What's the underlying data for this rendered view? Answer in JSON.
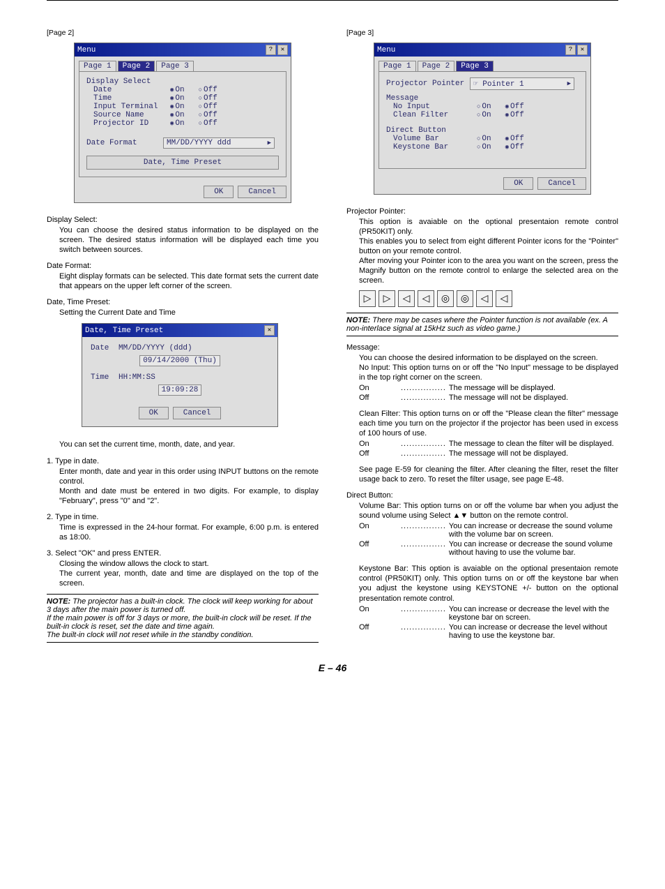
{
  "page2": {
    "heading": "[Page 2]",
    "dialog": {
      "title": "Menu",
      "tabs": [
        "Page 1",
        "Page 2",
        "Page 3"
      ],
      "activeTab": 1,
      "group": "Display Select",
      "rows": [
        {
          "label": "Date",
          "on": "On",
          "off": "Off",
          "sel": "on"
        },
        {
          "label": "Time",
          "on": "On",
          "off": "Off",
          "sel": "on"
        },
        {
          "label": "Input Terminal",
          "on": "On",
          "off": "Off",
          "sel": "on"
        },
        {
          "label": "Source Name",
          "on": "On",
          "off": "Off",
          "sel": "on"
        },
        {
          "label": "Projector ID",
          "on": "On",
          "off": "Off",
          "sel": "on"
        }
      ],
      "dateFormatLabel": "Date Format",
      "dateFormatValue": "MM/DD/YYYY ddd",
      "presetBtn": "Date, Time Preset",
      "ok": "OK",
      "cancel": "Cancel"
    },
    "displaySelect": {
      "title": "Display Select:",
      "p1": "You can choose the desired status information to be displayed on the screen. The desired status information will be displayed each time you switch between sources."
    },
    "dateFormat": {
      "title": "Date Format:",
      "p1": "Eight display formats can be selected. This date format sets the current date that appears on the upper left corner of the screen."
    },
    "dateTimePreset": {
      "title": "Date, Time Preset:",
      "p1": "Setting the Current Date and Time"
    },
    "dtDialog": {
      "title": "Date, Time Preset",
      "dateLabel": "Date",
      "dateFmt": "MM/DD/YYYY (ddd)",
      "dateVal": "09/14/2000 (Thu)",
      "timeLabel": "Time",
      "timeFmt": "HH:MM:SS",
      "timeVal": "19:09:28",
      "ok": "OK",
      "cancel": "Cancel"
    },
    "afterDt": "You can set the current time, month, date, and year.",
    "step1": {
      "h": "1. Type in date.",
      "p1": "Enter month, date and year in this order using INPUT buttons on the remote control.",
      "p2": "Month and date must be entered in two digits. For example, to display \"February\", press \"0\" and \"2\"."
    },
    "step2": {
      "h": "2. Type in time.",
      "p1": "Time is expressed in the 24-hour format. For example, 6:00 p.m. is entered as 18:00."
    },
    "step3": {
      "h": "3. Select \"OK\" and press ENTER.",
      "p1": "Closing the window allows the clock to start.",
      "p2": "The current year, month, date and time are displayed on the top of the screen."
    },
    "note1": {
      "label": "NOTE:",
      "l1": "The projector has a built-in clock. The clock will keep working for about 3 days after the main power is turned off.",
      "l2": "If the main power is off for 3 days or more, the built-in clock will be reset. If the built-in clock is reset, set the date and time again.",
      "l3": "The built-in clock will not reset while in the standby condition."
    }
  },
  "page3": {
    "heading": "[Page 3]",
    "dialog": {
      "title": "Menu",
      "tabs": [
        "Page 1",
        "Page 2",
        "Page 3"
      ],
      "activeTab": 2,
      "pointerLabel": "Projector Pointer",
      "pointerValue": "Pointer 1",
      "msgLabel": "Message",
      "msgRows": [
        {
          "label": "No Input",
          "on": "On",
          "off": "Off",
          "sel": "off"
        },
        {
          "label": "Clean Filter",
          "on": "On",
          "off": "Off",
          "sel": "off"
        }
      ],
      "dbLabel": "Direct Button",
      "dbRows": [
        {
          "label": "Volume Bar",
          "on": "On",
          "off": "Off",
          "sel": "off"
        },
        {
          "label": "Keystone Bar",
          "on": "On",
          "off": "Off",
          "sel": "off"
        }
      ],
      "ok": "OK",
      "cancel": "Cancel"
    },
    "projPointer": {
      "title": "Projector Pointer:",
      "p1": "This option is avaiable on the optional presentaion remote control (PR50KIT) only.",
      "p2": "This enables you to select from eight different Pointer icons for the \"Pointer\" button on your remote control.",
      "p3": "After moving your Pointer icon to the area you want on the screen, press the Magnify button on the remote control to enlarge the selected area on the screen."
    },
    "pointerIcons": [
      "▷",
      "▷",
      "◁",
      "◁",
      "◎",
      "◎",
      "◁",
      "◁"
    ],
    "note2": {
      "label": "NOTE:",
      "text": "There may be cases where the Pointer function is not available (ex. A non-interlace signal at 15kHz such as video game.)"
    },
    "message": {
      "title": "Message:",
      "p1": "You can choose the desired information to be displayed on the screen.",
      "p2": "No Input: This option turns on or off the \"No Input\" message to be displayed in the top right corner on the screen.",
      "onLine": "The message will be displayed.",
      "offLine": "The message will not be displayed.",
      "p3": "Clean Filter: This option turns on or off the \"Please clean the filter\" message each time you turn on the projector if the projector has been used in excess of 100 hours of use.",
      "onLine2": "The message to clean the filter will be displayed.",
      "offLine2": "The message will not be displayed.",
      "p4": "See page E-59 for cleaning the filter. After cleaning the filter, reset the filter usage back to zero. To reset the filter usage, see page E-48."
    },
    "direct": {
      "title": "Direct Button:",
      "vol": "Volume Bar: This option turns on or off the volume bar when you adjust the sound volume using Select ▲▼ button on the remote control.",
      "volOn": "You can increase or decrease the sound volume with the volume bar on screen.",
      "volOff": "You can increase or decrease the sound volume without having to use the volume bar.",
      "key": "Keystone Bar: This option is avaiable on the optional presentaion remote control (PR50KIT) only. This option turns on or off the keystone bar when you adjust the keystone using KEYSTONE +/- button on the optional presentation remote control.",
      "keyOn": "You can increase or decrease the level with the keystone bar on screen.",
      "keyOff": "You can increase or decrease the level without having to use the keystone bar."
    },
    "onWord": "On",
    "offWord": "Off",
    "dots": "................"
  },
  "footer": "E – 46"
}
